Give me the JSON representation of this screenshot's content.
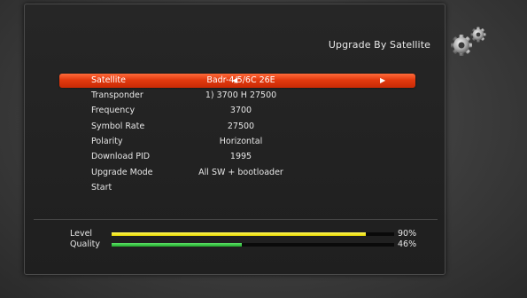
{
  "title": "Upgrade By Satellite",
  "icon": "settings-gears-icon",
  "colors": {
    "highlight": "#e33a0f",
    "level_bar": "#f2e300",
    "quality_bar": "#2fbf3a"
  },
  "menu": [
    {
      "label": "Satellite",
      "value": "Badr-4/5/6C 26E",
      "selected": true
    },
    {
      "label": "Transponder",
      "value": "1) 3700 H 27500"
    },
    {
      "label": "Frequency",
      "value": "3700"
    },
    {
      "label": "Symbol Rate",
      "value": "27500"
    },
    {
      "label": "Polarity",
      "value": "Horizontal"
    },
    {
      "label": "Download PID",
      "value": "1995"
    },
    {
      "label": "Upgrade Mode",
      "value": "All SW + bootloader"
    },
    {
      "label": "Start",
      "value": ""
    }
  ],
  "signal": {
    "level": {
      "label": "Level",
      "percent_text": "90%",
      "fraction": 0.9
    },
    "quality": {
      "label": "Quality",
      "percent_text": "46%",
      "fraction": 0.46
    }
  }
}
